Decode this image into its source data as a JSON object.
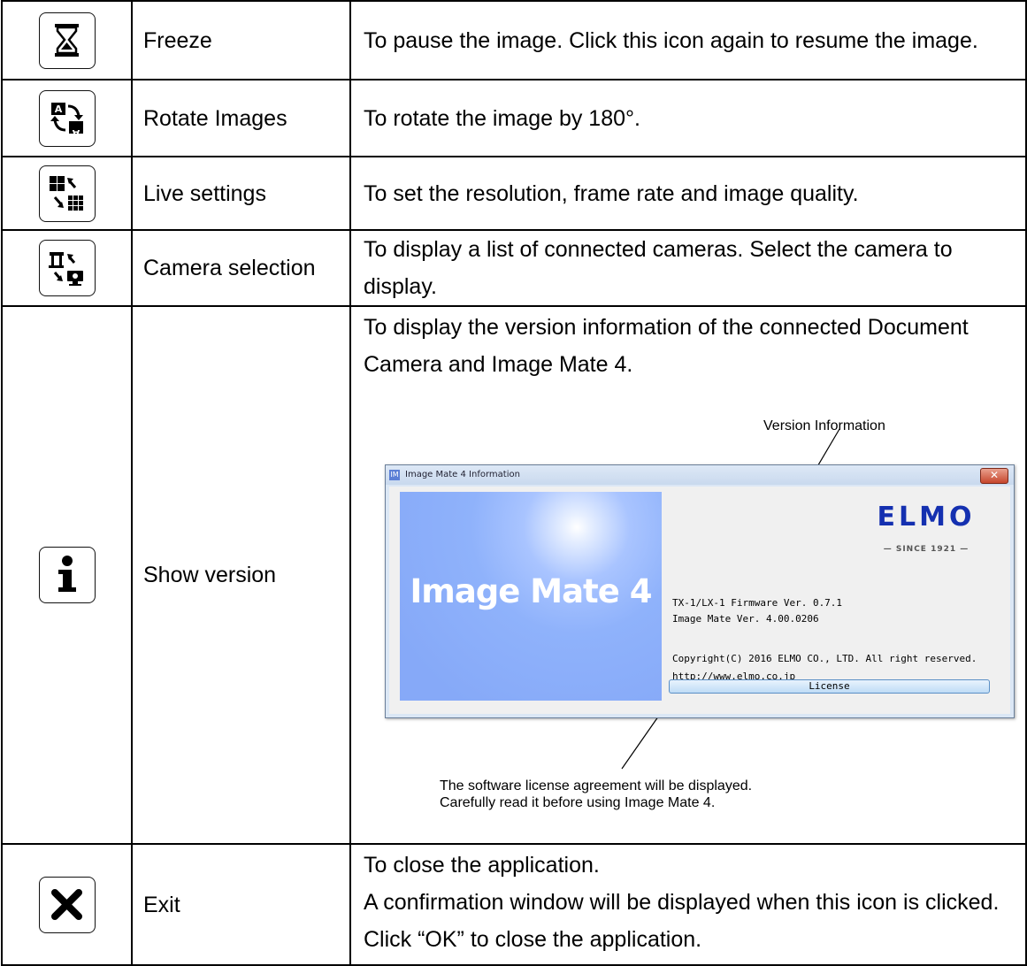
{
  "rows": [
    {
      "icon": "hourglass-icon",
      "name": "Freeze",
      "description": "To pause the image. Click this icon again to resume the image."
    },
    {
      "icon": "rotate-images-icon",
      "name": "Rotate Images",
      "description": "To rotate the image by 180°."
    },
    {
      "icon": "live-settings-icon",
      "name": "Live settings",
      "description": "To set the resolution, frame rate and image quality."
    },
    {
      "icon": "camera-selection-icon",
      "name": "Camera selection",
      "description": "To display a list of connected cameras. Select the camera to display."
    },
    {
      "icon": "info-icon",
      "name": "Show version",
      "description": "To display the version information of the connected Document Camera and Image Mate 4."
    },
    {
      "icon": "close-x-icon",
      "name": "Exit",
      "description_lines": [
        "To close the application.",
        "A confirmation window will be displayed when this icon is clicked. Click “OK” to close the application."
      ]
    }
  ],
  "version_figure": {
    "callout_version": "Version Information",
    "callout_license_lines": [
      "The software license agreement will be displayed.",
      "Carefully read it before using Image Mate 4."
    ],
    "window": {
      "app_icon_text": "IM",
      "title": "Image Mate 4 Information",
      "close_glyph": "✕",
      "splash_title": "Image Mate 4",
      "logo_text": "ELMO",
      "logo_since": "— SINCE 1921 —",
      "firmware_line": "TX-1/LX-1 Firmware Ver. 0.7.1",
      "app_version_line": "Image Mate Ver. 4.00.0206",
      "copyright_line": "Copyright(C) 2016 ELMO CO., LTD. All right reserved.",
      "url_line": "http://www.elmo.co.jp",
      "license_button": "License"
    }
  },
  "colors": {
    "splash": "#8fb2fb",
    "logo": "#1430b0",
    "license_button": "#bfdcf6",
    "close_button": "#c6462c"
  }
}
